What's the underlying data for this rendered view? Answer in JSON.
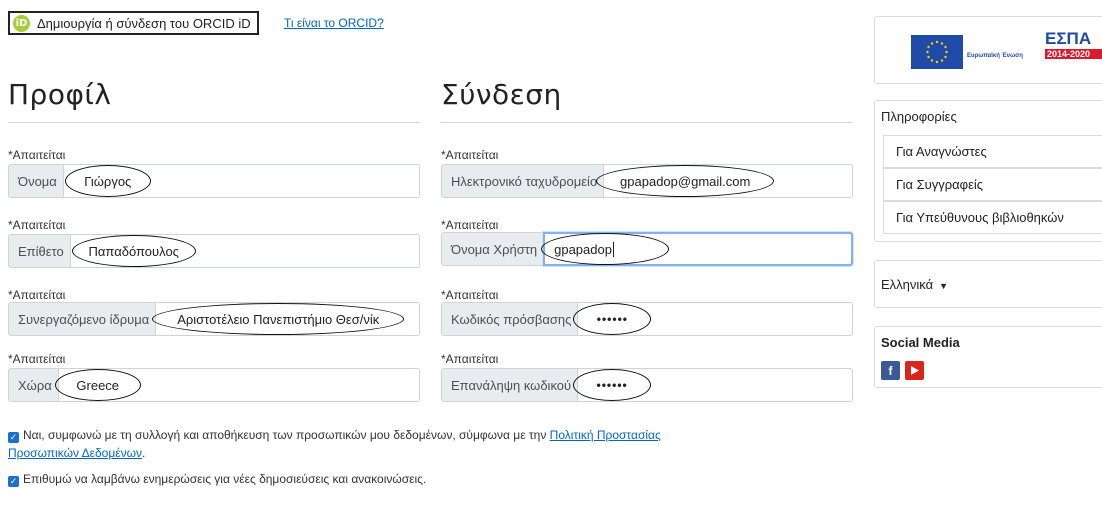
{
  "orcid": {
    "icon_text": "iD",
    "button_label": "Δημιουργία ή σύνδεση του ORCID iD",
    "link_label": "Τι είναι το ORCID?"
  },
  "profile": {
    "title": "Προφίλ",
    "fields": [
      {
        "required": "*Απαιτείται",
        "label": "Όνομα",
        "value": "Γιώργος"
      },
      {
        "required": "*Απαιτείται",
        "label": "Επίθετο",
        "value": "Παπαδόπουλος"
      },
      {
        "required": "*Απαιτείται",
        "label": "Συνεργαζόμενο ίδρυμα",
        "value": "Αριστοτέλειο Πανεπιστήμιο Θεσ/νίκ"
      },
      {
        "required": "*Απαιτείται",
        "label": "Χώρα",
        "value": "Greece"
      }
    ]
  },
  "login": {
    "title": "Σύνδεση",
    "fields": [
      {
        "required": "*Απαιτείται",
        "label": "Ηλεκτρονικό ταχυδρομείο",
        "value": "gpapadop@gmail.com"
      },
      {
        "required": "*Απαιτείται",
        "label": "Όνομα Χρήστη",
        "value": "gpapadop"
      },
      {
        "required": "*Απαιτείται",
        "label": "Κωδικός πρόσβασης",
        "value": "••••••"
      },
      {
        "required": "*Απαιτείται",
        "label": "Επανάληψη κωδικού",
        "value": "••••••"
      }
    ]
  },
  "consent": {
    "text": "Ναι, συμφωνώ με τη συλλογή και αποθήκευση των προσωπικών μου δεδομένων, σύμφωνα με την",
    "link_part1": "Πολιτική Προστασίας",
    "link_part2": "Προσωπικών Δεδομένων",
    "trailing": ".",
    "checked": true
  },
  "updates": {
    "text": "Επιθυμώ να λαμβάνω ενημερώσεις για νέες δημοσιεύσεις και ανακοινώσεις.",
    "checked": true
  },
  "sidebar": {
    "banner": {
      "eu_label": "Ευρωπαϊκή Ένωση",
      "espa_label": "ΕΣΠΑ",
      "espa_years": "2014-2020"
    },
    "info": {
      "title": "Πληροφορίες",
      "items": [
        "Για Αναγνώστες",
        "Για Συγγραφείς",
        "Για Υπεύθυνους βιβλιοθηκών"
      ]
    },
    "language": {
      "selected": "Ελληνικά"
    },
    "social": {
      "title": "Social Media",
      "icons": [
        "facebook-icon",
        "youtube-icon"
      ]
    }
  },
  "colors": {
    "link": "#0066cc",
    "checkbox": "#1a6fd0",
    "focus_border": "#80b2f0",
    "facebook": "#3b5998",
    "youtube": "#d9261c"
  }
}
